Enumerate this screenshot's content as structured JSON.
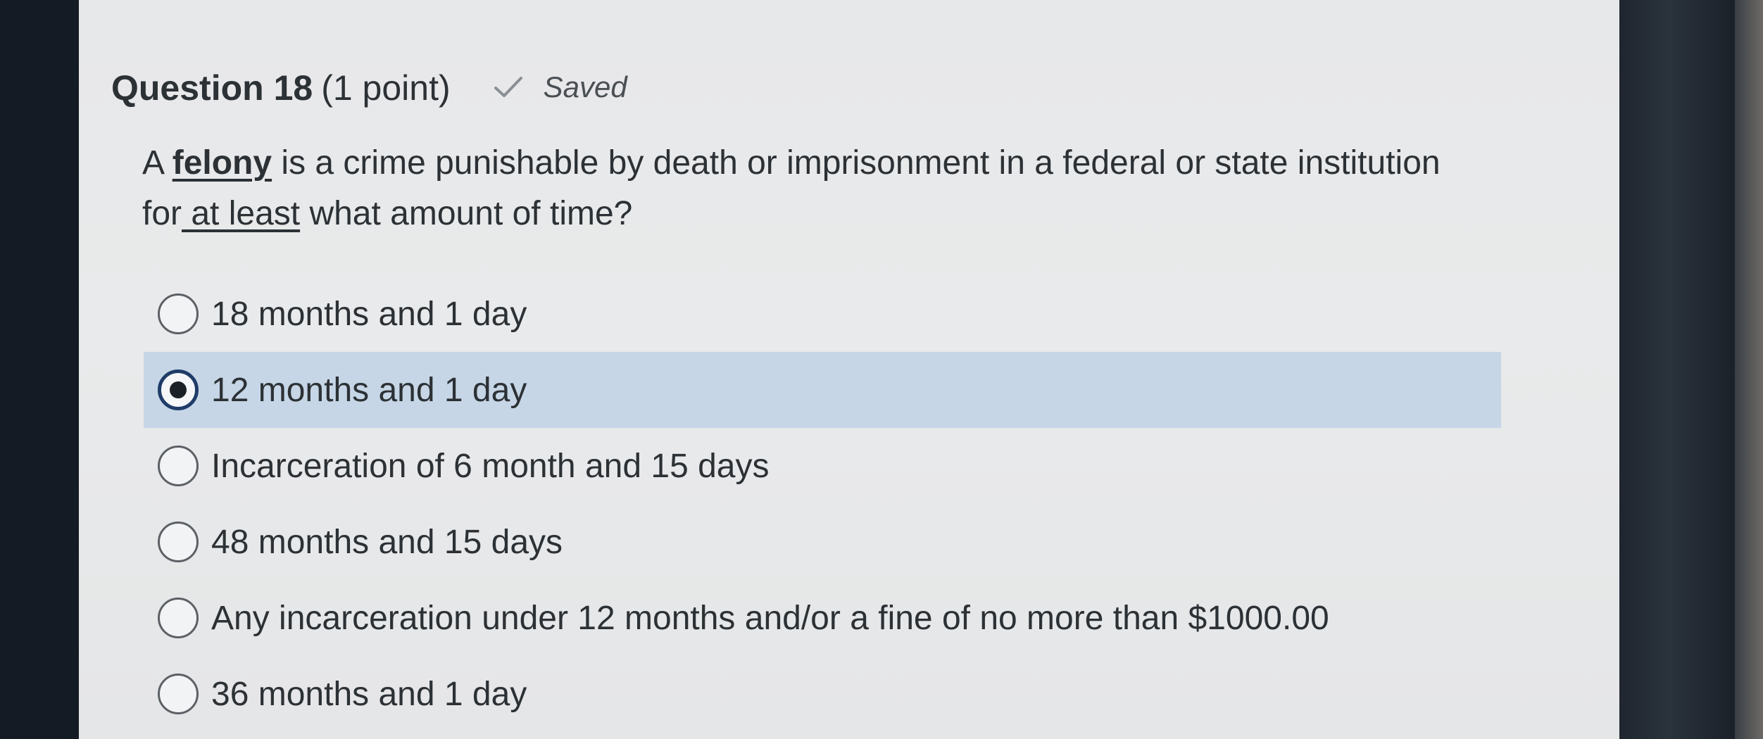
{
  "question": {
    "title": "Question 18",
    "points": "(1 point)",
    "status": "Saved",
    "status_icon": "checkmark-icon",
    "prompt": {
      "part1": "A ",
      "felony": "felony",
      "part2": " is a crime punishable by death or imprisonment in a federal or state institution for",
      "at_least": " at least",
      "part3": " what amount of time?"
    }
  },
  "options": [
    {
      "label": "18 months and 1 day",
      "selected": false
    },
    {
      "label": "12 months and 1 day",
      "selected": true
    },
    {
      "label": "Incarceration of 6 month and 15 days",
      "selected": false
    },
    {
      "label": "48 months and 15 days",
      "selected": false
    },
    {
      "label": "Any incarceration under 12 months and/or a fine of no more than $1000.00",
      "selected": false
    },
    {
      "label": "36 months and 1 day",
      "selected": false
    }
  ],
  "colors": {
    "selected_row": "#c6d6e6",
    "selected_radio_border": "#1f3c68",
    "text": "#2c3135"
  }
}
